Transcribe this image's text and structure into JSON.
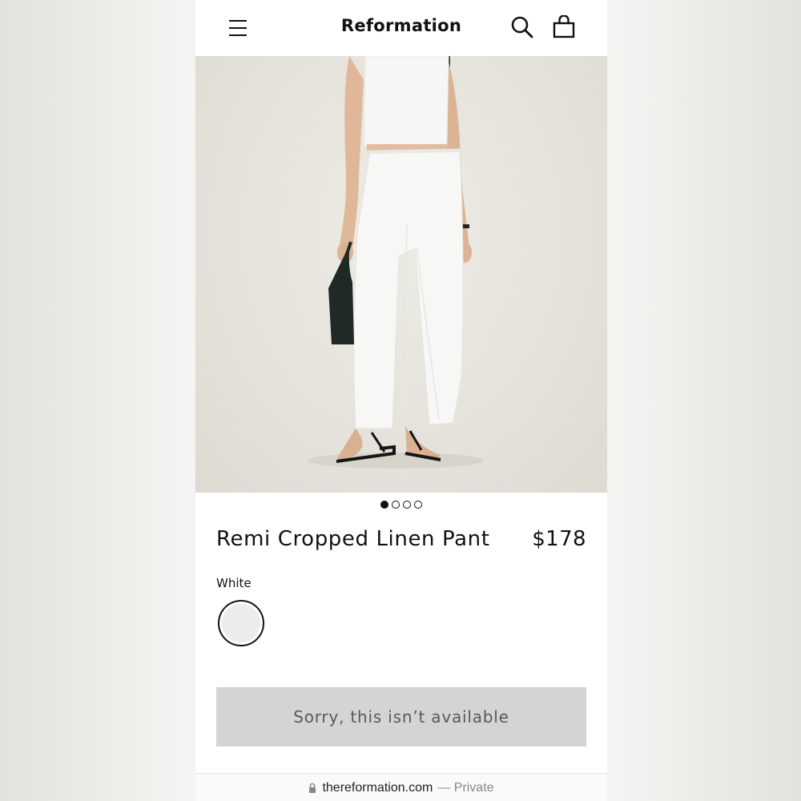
{
  "header": {
    "brand": "Reformation",
    "icons": [
      "menu-icon",
      "search-icon",
      "shopping-bag-icon"
    ]
  },
  "product": {
    "name": "Remi Cropped Linen Pant",
    "price": "$178",
    "color_name": "White",
    "image_count": 4,
    "active_image_index": 0,
    "availability_button": "Sorry, this isn’t available"
  },
  "browser": {
    "domain": "thereformation.com",
    "mode": "— Private",
    "icon": "lock-icon"
  },
  "colors": {
    "text": "#111111",
    "button_bg": "#d4d4d4",
    "button_text": "#5a5a5a",
    "swatch": "#ececee"
  }
}
